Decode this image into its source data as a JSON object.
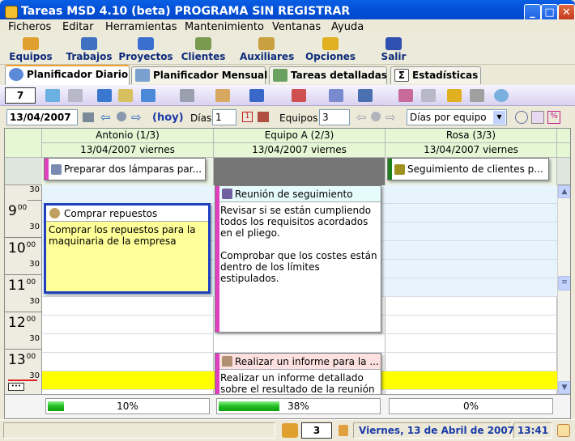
{
  "window": {
    "title": "Tareas MSD 4.10 (beta) PROGRAMA SIN REGISTRAR"
  },
  "menu": [
    "Ficheros",
    "Editar",
    "Herramientas",
    "Mantenimiento",
    "Ventanas",
    "Ayuda"
  ],
  "toolbar_big": [
    {
      "label": "Equipos",
      "icon": "team-icon",
      "color": "#e0a030"
    },
    {
      "label": "Trabajos",
      "icon": "jobs-icon",
      "color": "#4070c0"
    },
    {
      "label": "Proyectos",
      "icon": "projects-icon",
      "color": "#3a6fd0"
    },
    {
      "label": "Clientes",
      "icon": "clients-icon",
      "color": "#7a9a50"
    },
    {
      "label": "Auxiliares",
      "icon": "auxiliary-icon",
      "color": "#c8a040"
    },
    {
      "label": "Opciones",
      "icon": "options-icon",
      "color": "#e0b020"
    },
    {
      "label": "Salir",
      "icon": "exit-icon",
      "color": "#3050b0"
    }
  ],
  "tabs": [
    {
      "label": "Planificador Diario",
      "active": true
    },
    {
      "label": "Planificador Mensual",
      "active": false
    },
    {
      "label": "Tareas detalladas",
      "active": false
    },
    {
      "label": "Estadísticas",
      "active": false
    }
  ],
  "toolbar_small": {
    "number_box": "7"
  },
  "nav": {
    "date": "13/04/2007",
    "today_link": "(hoy)",
    "days_label": "Días",
    "days_value": "1",
    "teams_label": "Equipos",
    "teams_value": "3",
    "view_select": "Días por equipo"
  },
  "columns": [
    {
      "name": "Antonio (1/3)",
      "date": "13/04/2007 viernes",
      "progress": "10%",
      "progress_value": 10
    },
    {
      "name": "Equipo A (2/3)",
      "date": "13/04/2007 viernes",
      "progress": "38%",
      "progress_value": 38
    },
    {
      "name": "Rosa (3/3)",
      "date": "13/04/2007 viernes",
      "progress": "0%",
      "progress_value": 0
    }
  ],
  "allday_tasks": [
    {
      "col": 0,
      "title": "Preparar dos lámparas par...",
      "color": "#e040c0"
    },
    {
      "col": 2,
      "title": "Seguimiento de clientes p...",
      "color": "#208020"
    }
  ],
  "time_labels": {
    "hours": [
      "9",
      "10",
      "11",
      "12",
      "13"
    ],
    "minutes_00": "00",
    "minutes_30": "30"
  },
  "tasks": [
    {
      "col": 0,
      "title": "Comprar repuestos",
      "body": "Comprar los repuestos para la maquinaria de la empresa",
      "bar_color": "#2040c0",
      "bg": "#ffff99"
    },
    {
      "col": 1,
      "title": "Reunión de seguimiento",
      "body": "Revisar si se están cumpliendo todos los requisitos acordados en el pliego.\n\nComprobar que los costes están dentro de los límites estipulados.",
      "bar_color": "#e040c0",
      "hdr_bg": "#e6fbfb"
    },
    {
      "col": 1,
      "title": "Realizar un informe para la ...",
      "body": "Realizar un informe detallado sobre el resultado de la reunión",
      "bar_color": "#e040c0",
      "hdr_bg": "#fde0e0"
    }
  ],
  "status": {
    "count": "3",
    "date": "Viernes, 13 de Abril de 2007",
    "time": "13:41"
  }
}
